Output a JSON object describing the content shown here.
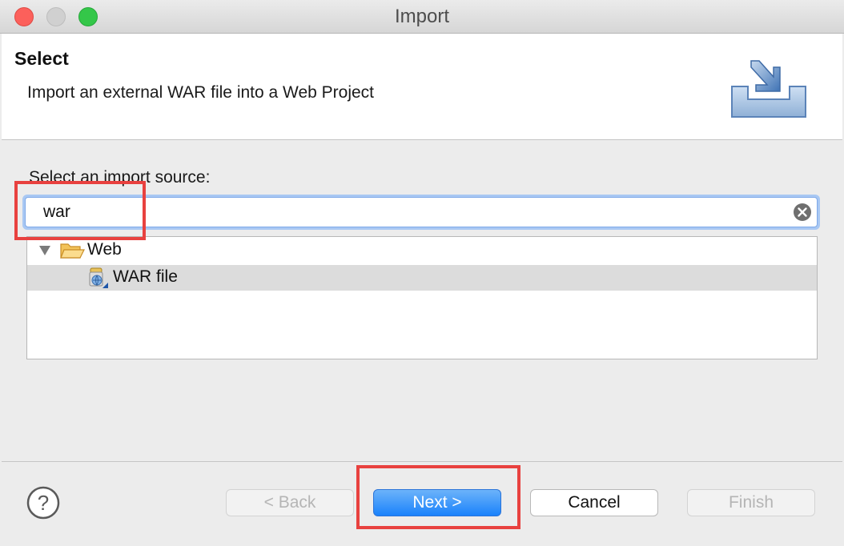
{
  "window": {
    "title": "Import"
  },
  "banner": {
    "title": "Select",
    "description": "Import an external WAR file into a Web Project",
    "icon": "import-wizard-icon"
  },
  "source": {
    "label": "Select an import source:",
    "filter_value": "war"
  },
  "tree": {
    "items": [
      {
        "label": "Web",
        "type": "folder",
        "expanded": true,
        "icon": "folder-open-icon"
      },
      {
        "label": "WAR file",
        "type": "item",
        "selected": true,
        "icon": "war-file-icon"
      }
    ]
  },
  "buttons": {
    "back": "< Back",
    "next": "Next >",
    "cancel": "Cancel",
    "finish": "Finish"
  },
  "colors": {
    "highlight": "#e8413f",
    "accent": "#1a82fb",
    "selection": "#dcdcdc"
  }
}
